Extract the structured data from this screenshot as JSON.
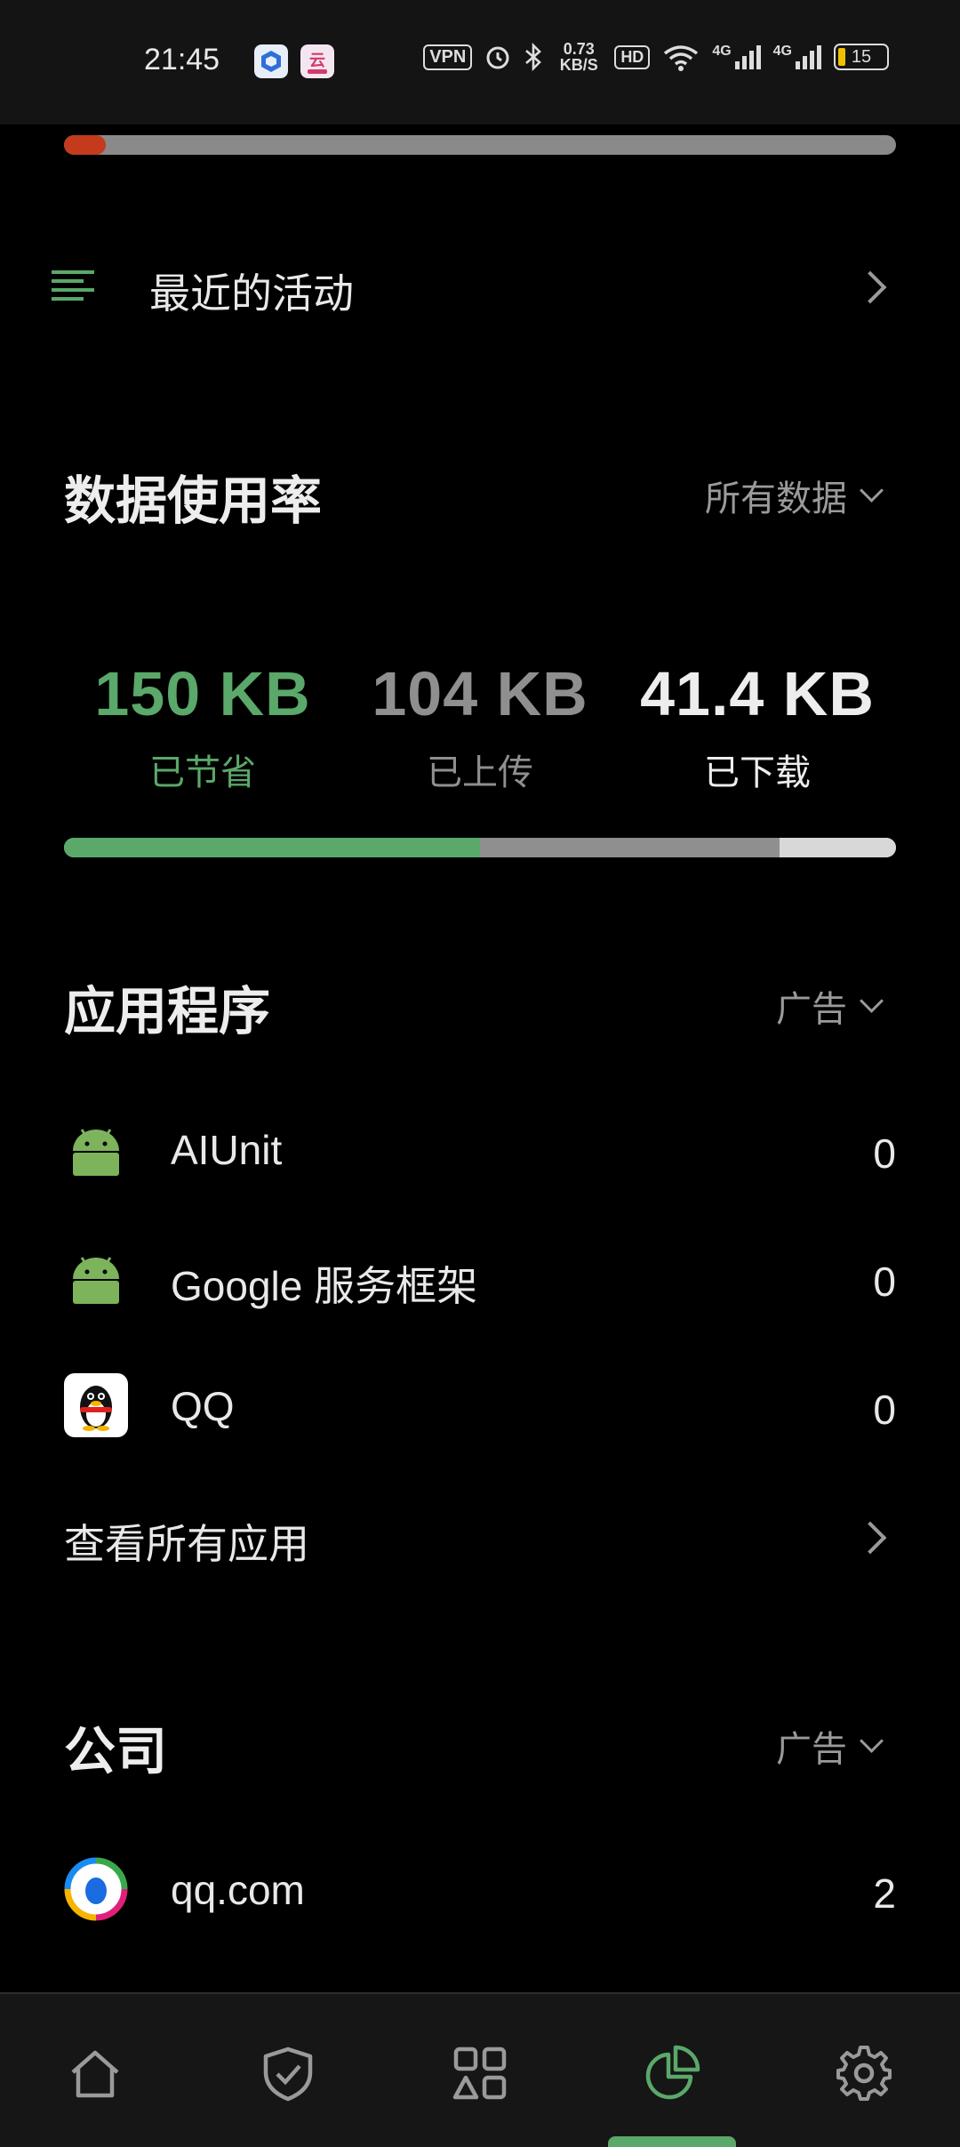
{
  "status_bar": {
    "time": "21:45",
    "vpn": "VPN",
    "net_speed": "0.73 KB/S",
    "hd": "HD",
    "net1": "4G",
    "net2": "4G",
    "battery": "15"
  },
  "top_progress": {
    "fraction": 0.05,
    "color": "#c43a1c"
  },
  "recent_activity": {
    "label": "最近的活动",
    "icon": "list-icon"
  },
  "data_usage": {
    "title": "数据使用率",
    "filter": "所有数据",
    "stats": [
      {
        "value": "150 KB",
        "label": "已节省",
        "color": "#5aa86a"
      },
      {
        "value": "104 KB",
        "label": "已上传",
        "color": "#8f8f8f"
      },
      {
        "value": "41.4 KB",
        "label": "已下载",
        "color": "#ededed"
      }
    ],
    "bar": [
      {
        "fraction": 0.5,
        "color": "#5aa86a"
      },
      {
        "fraction": 0.36,
        "color": "#8f8f8f"
      },
      {
        "fraction": 0.14,
        "color": "#d8d8d8"
      }
    ]
  },
  "apps": {
    "title": "应用程序",
    "filter": "广告",
    "items": [
      {
        "name": "AIUnit",
        "count": "0",
        "icon": "android-icon"
      },
      {
        "name": "Google 服务框架",
        "count": "0",
        "icon": "android-icon"
      },
      {
        "name": "QQ",
        "count": "0",
        "icon": "qq-penguin-icon"
      }
    ],
    "view_all": "查看所有应用"
  },
  "companies": {
    "title": "公司",
    "filter": "广告",
    "items": [
      {
        "name": "qq.com",
        "count": "2",
        "icon": "tencent-icon"
      }
    ]
  },
  "nav": {
    "items": [
      "home-icon",
      "shield-check-icon",
      "apps-grid-icon",
      "pie-chart-icon",
      "gear-icon"
    ],
    "active": "pie-chart-icon",
    "accent": "#5aa86a"
  }
}
